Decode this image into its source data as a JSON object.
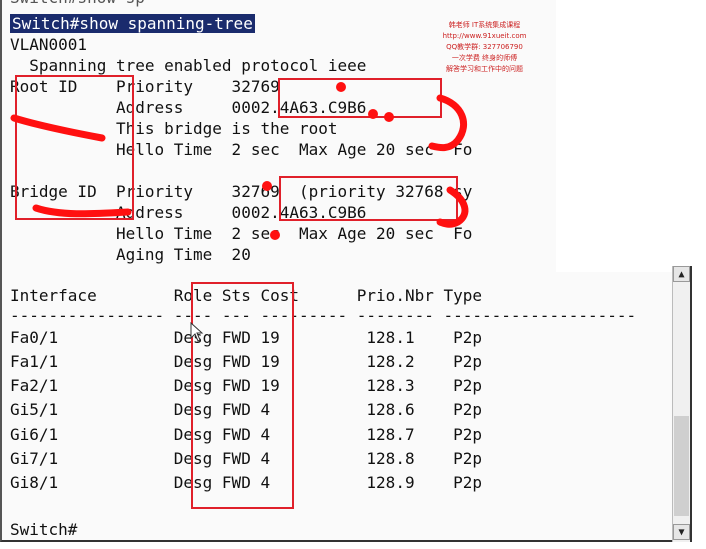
{
  "terminal": {
    "top_cut": "Switch#show sp",
    "command": "Switch#show spanning-tree",
    "vlan": "VLAN0001",
    "protocol_line": "  Spanning tree enabled protocol ieee",
    "root_priority": "Root ID    Priority    32769",
    "root_address": "           Address     0002.4A63.C9B6",
    "root_note": "           This bridge is the root",
    "root_hello": "           Hello Time  2 sec  Max Age 20 sec  Fo",
    "bridge_priority": "Bridge ID  Priority    32769  (priority 32768 sy",
    "bridge_address": "           Address     0002.4A63.C9B6",
    "bridge_hello": "           Hello Time  2 sec  Max Age 20 sec  Fo",
    "bridge_aging": "           Aging Time  20",
    "table_header": "Interface        Role Sts Cost      Prio.Nbr Type",
    "table_divider": "---------------- ---- --- --------- -------- --------------------",
    "rows": [
      "Fa0/1            Desg FWD 19         128.1    P2p",
      "Fa1/1            Desg FWD 19         128.2    P2p",
      "Fa2/1            Desg FWD 19         128.3    P2p",
      "Gi5/1            Desg FWD 4          128.6    P2p",
      "Gi6/1            Desg FWD 4          128.7    P2p",
      "Gi7/1            Desg FWD 4          128.8    P2p",
      "Gi8/1            Desg FWD 4          128.9    P2p"
    ],
    "prompt": "Switch#"
  },
  "watermark": {
    "line1": "韩老师 IT系统集成课程",
    "line2": "http://www.91xueit.com",
    "line3": "QQ教学群: 327706790",
    "line4": "一次学费  终身的师傅",
    "line5": "解答学习和工作中的问题"
  },
  "scrollbar": {
    "up_arrow": "▲",
    "down_arrow": "▼"
  },
  "colors": {
    "annotation": "#e0202a",
    "command_bg": "#1a2b6d"
  }
}
